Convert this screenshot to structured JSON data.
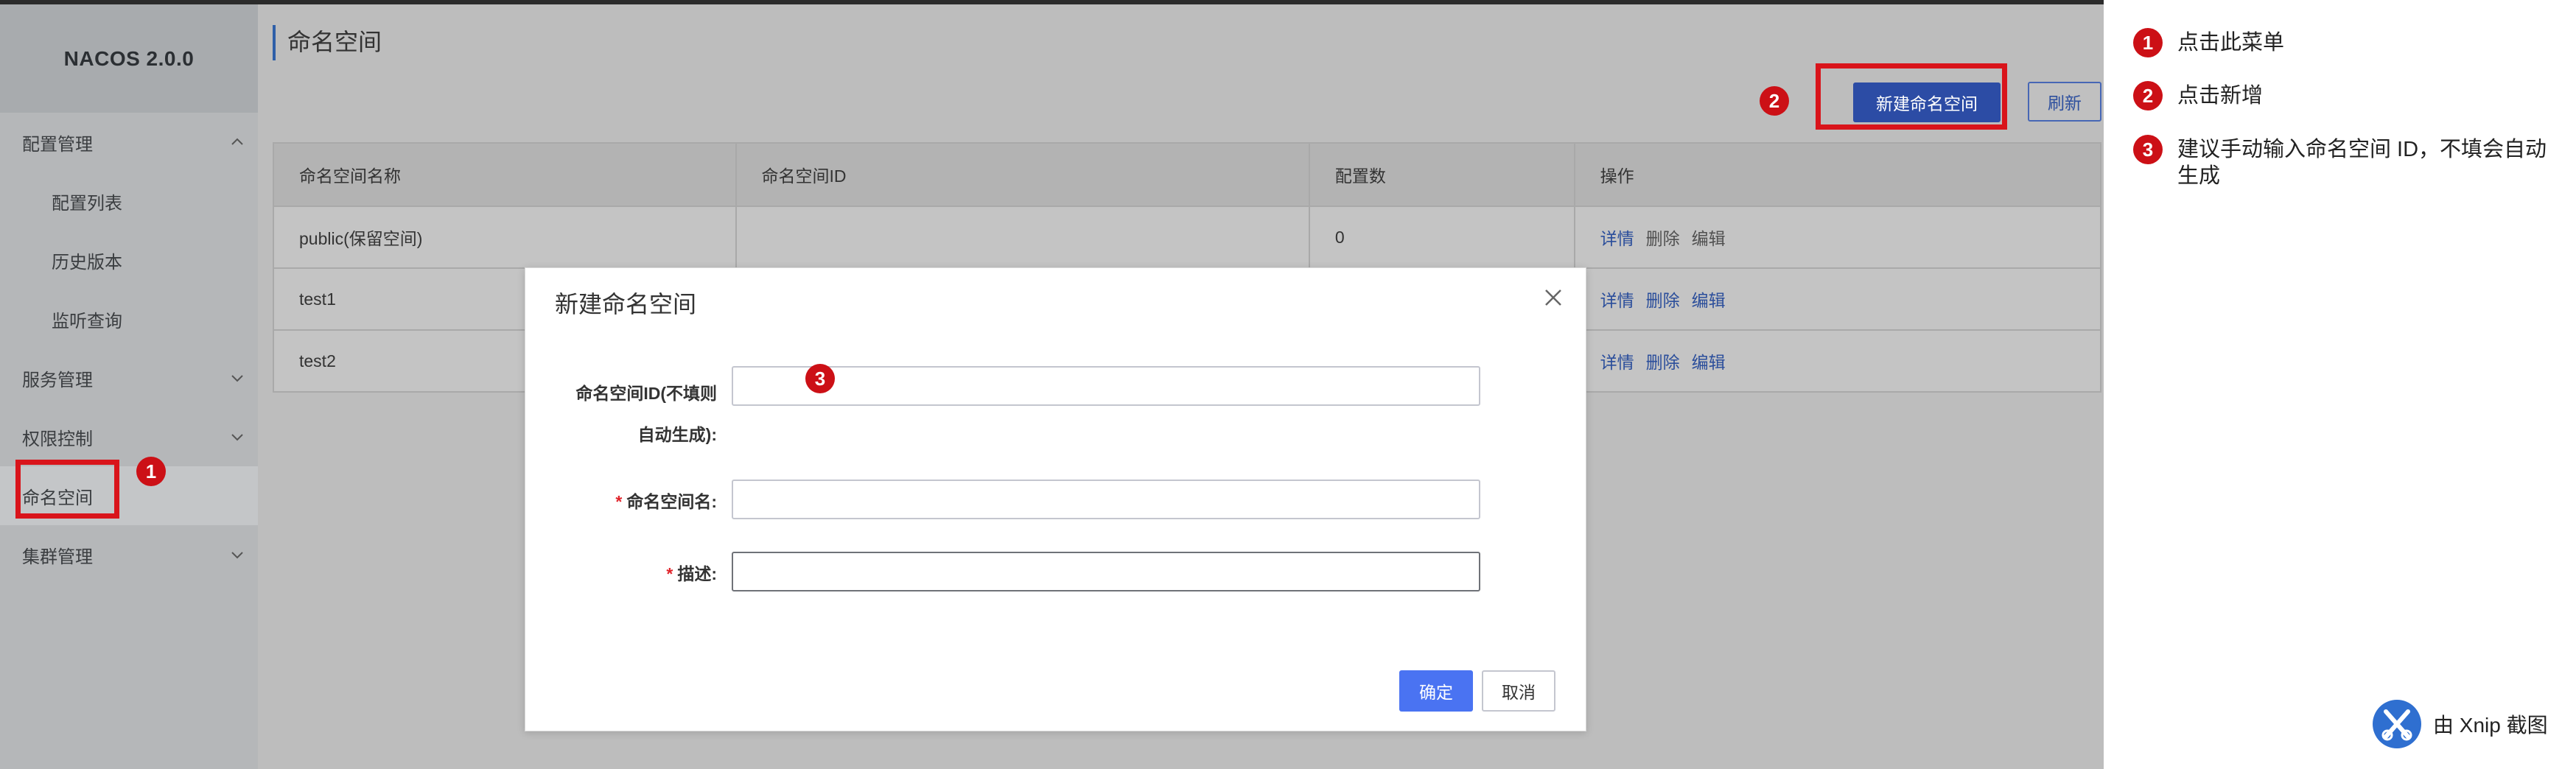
{
  "app": {
    "brand": "NACOS 2.0.0"
  },
  "sidebar": {
    "items": [
      {
        "label": "配置管理",
        "level": 1,
        "expanded": true
      },
      {
        "label": "配置列表",
        "level": 2
      },
      {
        "label": "历史版本",
        "level": 2
      },
      {
        "label": "监听查询",
        "level": 2
      },
      {
        "label": "服务管理",
        "level": 1,
        "expanded": false
      },
      {
        "label": "权限控制",
        "level": 1,
        "expanded": false
      },
      {
        "label": "命名空间",
        "level": 1,
        "active": true
      },
      {
        "label": "集群管理",
        "level": 1,
        "expanded": false
      }
    ]
  },
  "page": {
    "title": "命名空间",
    "new_button": "新建命名空间",
    "refresh_button": "刷新"
  },
  "table": {
    "columns": [
      "命名空间名称",
      "命名空间ID",
      "配置数",
      "操作"
    ],
    "rows": [
      {
        "name": "public(保留空间)",
        "id": "",
        "count": "0",
        "ops": [
          "详情",
          "删除",
          "编辑"
        ]
      },
      {
        "name": "test1",
        "id": "",
        "count": "",
        "ops": [
          "详情",
          "删除",
          "编辑"
        ]
      },
      {
        "name": "test2",
        "id": "",
        "count": "",
        "ops": [
          "详情",
          "删除",
          "编辑"
        ]
      }
    ]
  },
  "modal": {
    "title": "新建命名空间",
    "fields": [
      {
        "label_line1": "命名空间ID(不填则",
        "label_line2": "自动生成):",
        "required": false,
        "value": ""
      },
      {
        "label": "命名空间名:",
        "required": true,
        "value": ""
      },
      {
        "label": "描述:",
        "required": true,
        "value": ""
      }
    ],
    "required_mark": "*",
    "ok_button": "确定",
    "cancel_button": "取消"
  },
  "annotations": {
    "steps": [
      {
        "num": "1",
        "text": "点击此菜单"
      },
      {
        "num": "2",
        "text": "点击新增"
      },
      {
        "num": "3",
        "text": "建议手动输入命名空间 ID，不填会自动生成"
      }
    ],
    "watermark": "由 Xnip 截图",
    "marker_color": "#cc1016"
  },
  "colors": {
    "primary": "#4a73f2",
    "highlight_box": "#d9141b",
    "link": "#2b4e9b"
  }
}
